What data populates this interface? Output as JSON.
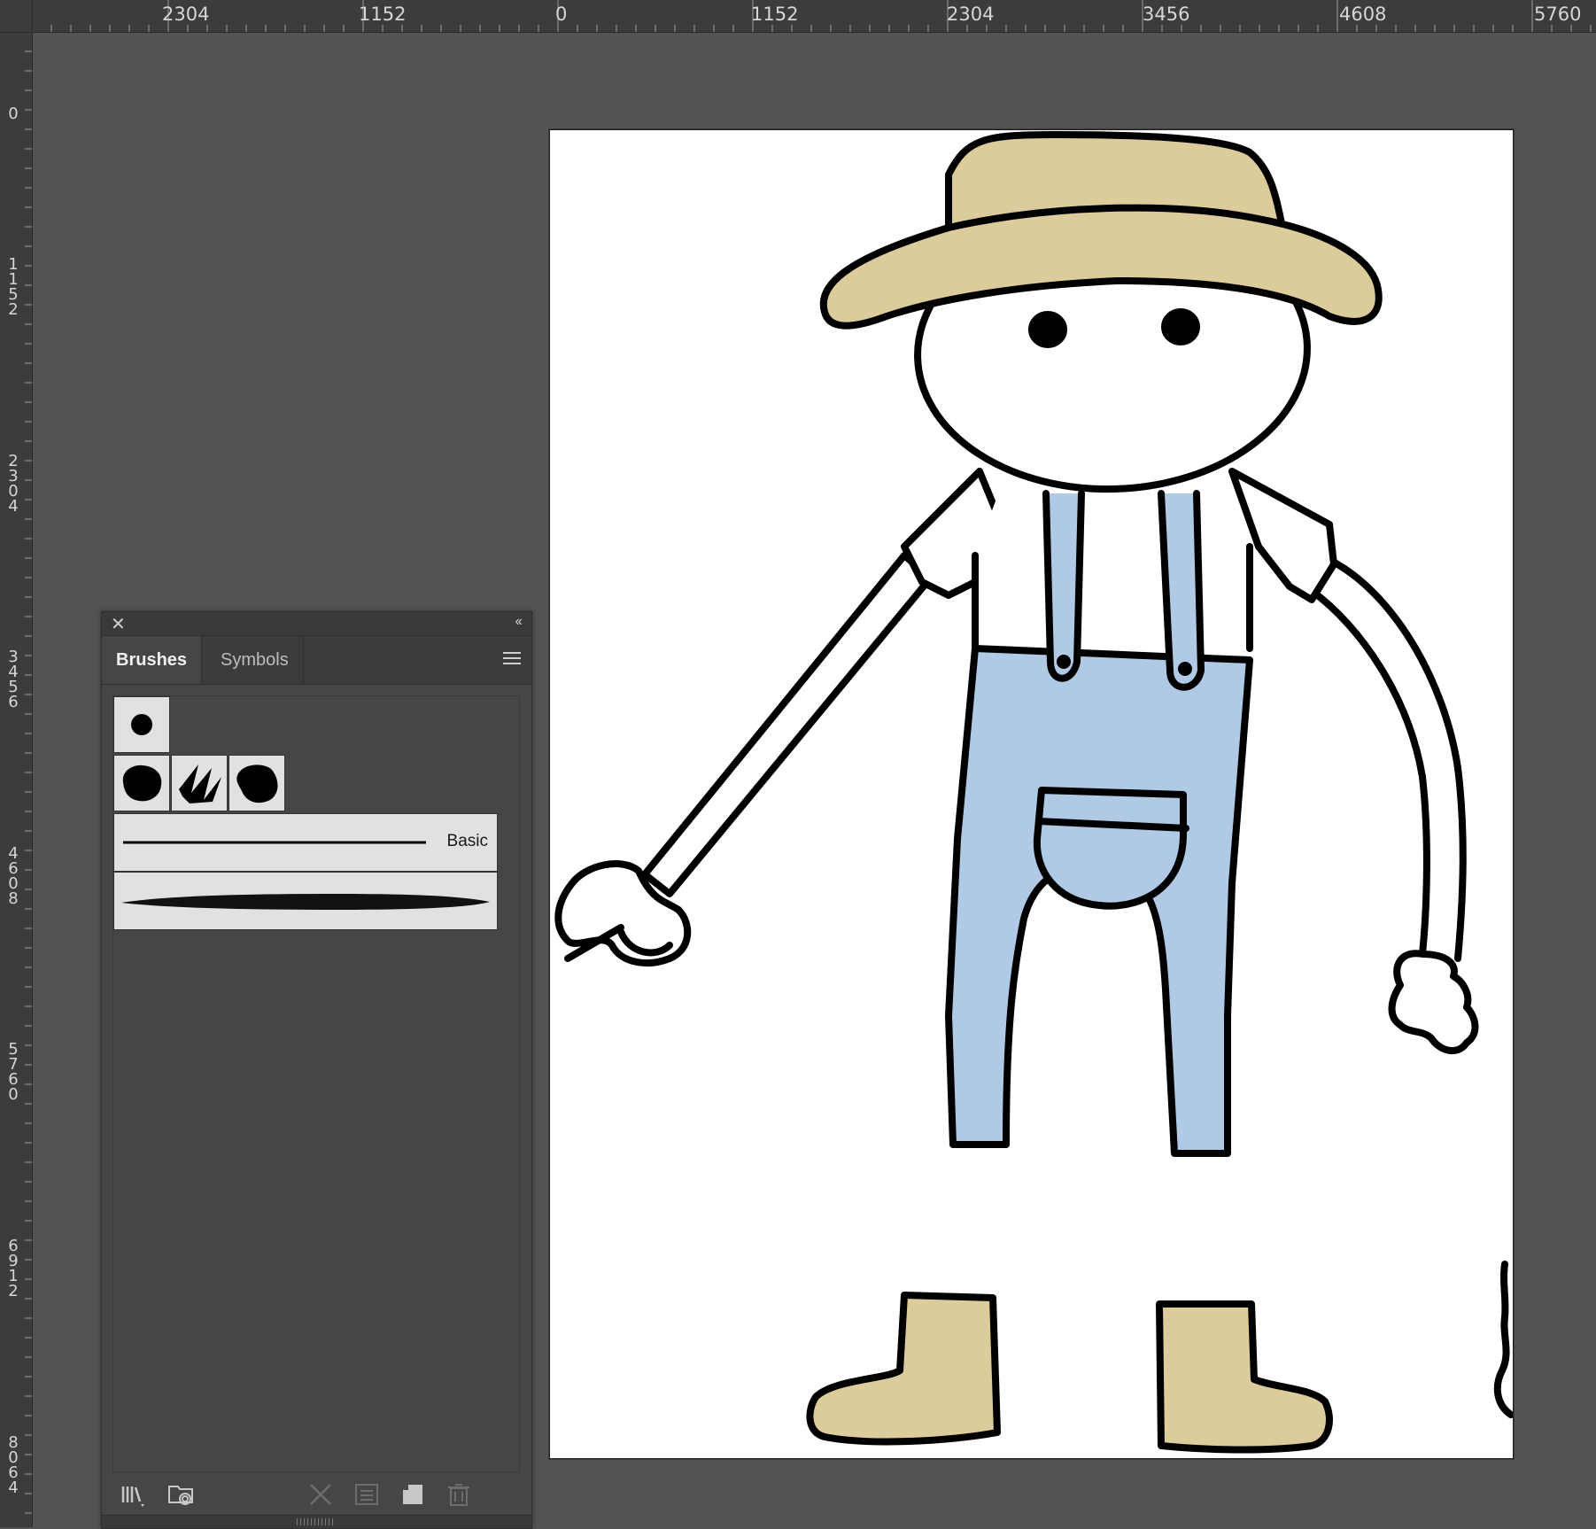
{
  "rulers": {
    "horizontal_labels": [
      "2304",
      "1152",
      "0",
      "1152",
      "2304",
      "3456",
      "4608",
      "5760"
    ],
    "vertical_labels": [
      "0",
      "1152",
      "2304",
      "3456",
      "4608",
      "5760",
      "6912",
      "8064"
    ]
  },
  "panel": {
    "close_icon": "close-icon",
    "collapse_icon": "double-chevron-left-icon",
    "tabs": [
      {
        "label": "Brushes",
        "active": true
      },
      {
        "label": "Symbols",
        "active": false
      }
    ],
    "menu_icon": "hamburger-menu-icon",
    "brushes": {
      "calligraphic": [
        "round-dot-brush"
      ],
      "scatter": [
        "blob-brush",
        "scribble-brush",
        "splatter-brush"
      ],
      "art": [
        {
          "name": "Basic",
          "label": "Basic"
        },
        {
          "name": "charcoal-brush",
          "label": ""
        }
      ]
    },
    "footer_icons": [
      "brush-libraries-menu-icon",
      "libraries-panel-icon",
      "remove-brush-stroke-icon",
      "brush-options-icon",
      "new-brush-icon",
      "delete-brush-icon"
    ]
  },
  "artwork": {
    "subject": "farmer",
    "colors": {
      "hat": "#dccc9c",
      "overalls": "#b0cae6",
      "boots": "#dccc9c",
      "outline": "#000000",
      "shirt": "#ffffff"
    }
  },
  "colors": {
    "canvas_bg": "#535353",
    "ruler_bg": "#3c3c3c",
    "panel_bg": "#464646",
    "swatch_bg": "#e1e1e1"
  }
}
